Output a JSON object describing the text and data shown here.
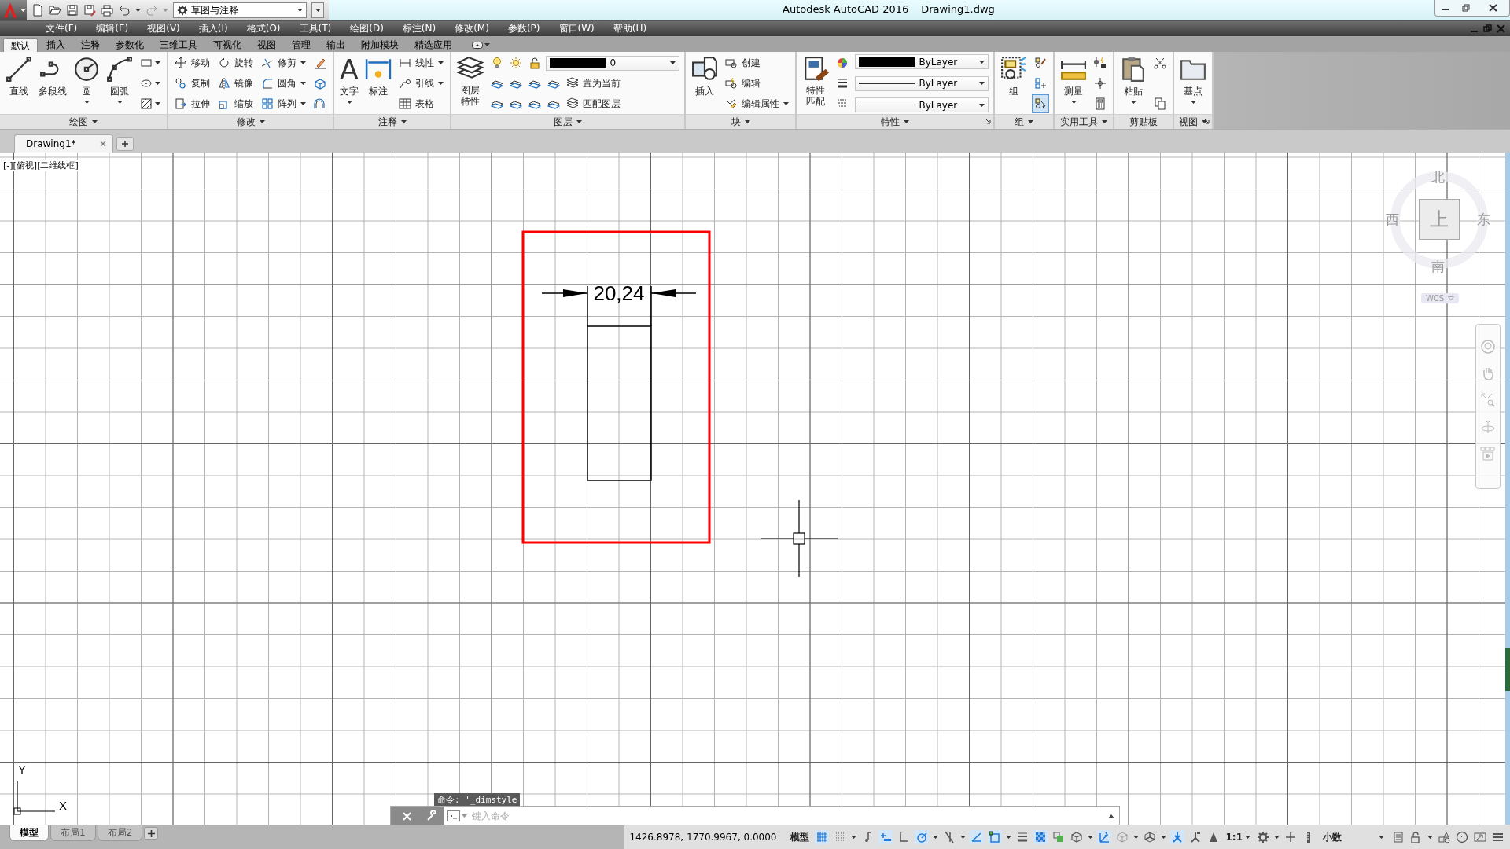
{
  "title_bar": {
    "workspace": "草图与注释",
    "title": "Autodesk AutoCAD 2016",
    "document": "Drawing1.dwg"
  },
  "menu_bar": [
    "文件(F)",
    "编辑(E)",
    "视图(V)",
    "插入(I)",
    "格式(O)",
    "工具(T)",
    "绘图(D)",
    "标注(N)",
    "修改(M)",
    "参数(P)",
    "窗口(W)",
    "帮助(H)"
  ],
  "ribbon_tabs": [
    {
      "label": "默认",
      "selected": true
    },
    {
      "label": "插入",
      "selected": false
    },
    {
      "label": "注释",
      "selected": false
    },
    {
      "label": "参数化",
      "selected": false
    },
    {
      "label": "三维工具",
      "selected": false
    },
    {
      "label": "可视化",
      "selected": false
    },
    {
      "label": "视图",
      "selected": false
    },
    {
      "label": "管理",
      "selected": false
    },
    {
      "label": "输出",
      "selected": false
    },
    {
      "label": "附加模块",
      "selected": false
    },
    {
      "label": "精选应用",
      "selected": false
    }
  ],
  "ribbon_panels": [
    {
      "title": "绘图",
      "expandable": true,
      "launcher": false,
      "columns": [
        [
          {
            "kind": "large",
            "label": "直线",
            "dropdown": false
          }
        ],
        [
          {
            "kind": "large",
            "label": "多段线",
            "dropdown": false
          }
        ],
        [
          {
            "kind": "large",
            "label": "圆",
            "dropdown": true
          }
        ],
        [
          {
            "kind": "large",
            "label": "圆弧",
            "dropdown": true
          }
        ],
        [
          {
            "kind": "icon",
            "dropdown": true
          },
          {
            "kind": "icon",
            "dropdown": true
          },
          {
            "kind": "icon",
            "dropdown": true
          }
        ]
      ]
    },
    {
      "title": "修改",
      "expandable": true,
      "launcher": false,
      "columns": [
        [
          {
            "kind": "small",
            "label": "移动",
            "dropdown": false
          },
          {
            "kind": "small",
            "label": "复制",
            "dropdown": false
          },
          {
            "kind": "small",
            "label": "拉伸",
            "dropdown": false
          }
        ],
        [
          {
            "kind": "small",
            "label": "旋转",
            "dropdown": false
          },
          {
            "kind": "small",
            "label": "镜像",
            "dropdown": false
          },
          {
            "kind": "small",
            "label": "缩放",
            "dropdown": false
          }
        ],
        [
          {
            "kind": "small",
            "label": "修剪",
            "dropdown": true
          },
          {
            "kind": "small",
            "label": "圆角",
            "dropdown": true
          },
          {
            "kind": "small",
            "label": "阵列",
            "dropdown": true
          }
        ],
        [
          {
            "kind": "icon",
            "dropdown": false
          },
          {
            "kind": "icon",
            "dropdown": false
          },
          {
            "kind": "icon",
            "dropdown": false
          }
        ]
      ]
    },
    {
      "title": "注释",
      "expandable": true,
      "launcher": false,
      "columns": [
        [
          {
            "kind": "large",
            "label": "文字",
            "glyph": "A",
            "dropdown": true
          }
        ],
        [
          {
            "kind": "large",
            "label": "标注",
            "dropdown": false
          }
        ],
        [
          {
            "kind": "small",
            "label": "线性",
            "dropdown": true
          },
          {
            "kind": "small",
            "label": "引线",
            "dropdown": true
          },
          {
            "kind": "small",
            "label": "表格",
            "dropdown": false
          }
        ]
      ]
    },
    {
      "title": "图层",
      "expandable": true,
      "launcher": false,
      "columns": [
        [
          {
            "kind": "large",
            "label": "图层特性",
            "dropdown": false
          }
        ],
        [
          {
            "kind": "row",
            "items": [
              {
                "kind": "icon",
                "dropdown": false
              },
              {
                "kind": "icon",
                "dropdown": false
              },
              {
                "kind": "icon",
                "dropdown": false
              },
              {
                "kind": "combo",
                "value": "0",
                "swatch": true
              }
            ]
          },
          {
            "kind": "row",
            "items": [
              {
                "kind": "icon",
                "dropdown": false
              },
              {
                "kind": "icon",
                "dropdown": false
              },
              {
                "kind": "icon",
                "dropdown": false
              },
              {
                "kind": "icon",
                "dropdown": false
              },
              {
                "kind": "small",
                "label": "置为当前",
                "dropdown": false
              }
            ]
          },
          {
            "kind": "row",
            "items": [
              {
                "kind": "icon",
                "dropdown": false
              },
              {
                "kind": "icon",
                "dropdown": false
              },
              {
                "kind": "icon",
                "dropdown": false
              },
              {
                "kind": "icon",
                "dropdown": false
              },
              {
                "kind": "small",
                "label": "匹配图层",
                "dropdown": false
              }
            ]
          }
        ]
      ]
    },
    {
      "title": "块",
      "expandable": true,
      "launcher": false,
      "columns": [
        [
          {
            "kind": "large",
            "label": "插入",
            "dropdown": false
          }
        ],
        [
          {
            "kind": "small",
            "label": "创建",
            "dropdown": false
          },
          {
            "kind": "small",
            "label": "编辑",
            "dropdown": false
          },
          {
            "kind": "small",
            "label": "编辑属性",
            "dropdown": true
          }
        ]
      ]
    },
    {
      "title": "特性",
      "expandable": true,
      "launcher": true,
      "columns": [
        [
          {
            "kind": "large",
            "label": "特性匹配",
            "dropdown": false
          }
        ],
        [
          {
            "kind": "icon",
            "dropdown": false
          },
          {
            "kind": "icon",
            "dropdown": false
          },
          {
            "kind": "icon",
            "dropdown": false
          }
        ],
        [
          {
            "kind": "combo",
            "value": "ByLayer",
            "swatch": true
          },
          {
            "kind": "combo",
            "value": "ByLayer",
            "swatch": false
          },
          {
            "kind": "combo",
            "value": "ByLayer",
            "swatch": false
          }
        ]
      ]
    },
    {
      "title": "组",
      "expandable": true,
      "launcher": false,
      "columns": [
        [
          {
            "kind": "large",
            "label": "组",
            "dropdown": false
          }
        ],
        [
          {
            "kind": "icon",
            "dropdown": false,
            "on": false
          },
          {
            "kind": "icon",
            "dropdown": false,
            "on": false
          },
          {
            "kind": "icon",
            "dropdown": false,
            "on": true
          }
        ]
      ]
    },
    {
      "title": "实用工具",
      "expandable": true,
      "launcher": false,
      "columns": [
        [
          {
            "kind": "large",
            "label": "测量",
            "dropdown": true
          }
        ],
        [
          {
            "kind": "icon",
            "dropdown": false
          },
          {
            "kind": "icon",
            "dropdown": false
          },
          {
            "kind": "icon",
            "dropdown": false
          }
        ]
      ]
    },
    {
      "title": "剪贴板",
      "expandable": false,
      "launcher": false,
      "columns": [
        [
          {
            "kind": "large",
            "label": "粘贴",
            "dropdown": true
          }
        ],
        [
          {
            "kind": "icon",
            "dropdown": false
          },
          {
            "kind": "icon",
            "dropdown": false
          }
        ]
      ]
    },
    {
      "title": "视图",
      "expandable": true,
      "launcher": true,
      "columns": [
        [
          {
            "kind": "large",
            "label": "基点",
            "dropdown": true
          }
        ]
      ]
    }
  ],
  "document_tabs": [
    {
      "label": "Drawing1*",
      "selected": true
    }
  ],
  "viewport": {
    "label": "[-][俯视][二维线框]",
    "dimension_text": "20,24",
    "axis_y": "Y",
    "axis_x": "X"
  },
  "view_cube": {
    "north": "北",
    "west": "西",
    "east": "东",
    "south": "南",
    "face": "上",
    "coordinate_system": "WCS"
  },
  "command_line": {
    "history": "命令: '_dimstyle",
    "placeholder": "键入命令"
  },
  "layout_tabs": [
    {
      "label": "模型",
      "selected": true
    },
    {
      "label": "布局1",
      "selected": false
    },
    {
      "label": "布局2",
      "selected": false
    }
  ],
  "coordinates": "1426.8978, 1770.9967, 0.0000",
  "status_tools": [
    {
      "kind": "text",
      "label": "模型",
      "dropdown": false
    },
    {
      "kind": "icon",
      "on": true,
      "dropdown": false
    },
    {
      "kind": "icon",
      "on": false,
      "dropdown": true
    },
    {
      "kind": "icon",
      "on": false,
      "dropdown": false
    },
    {
      "kind": "icon",
      "on": true,
      "dropdown": false
    },
    {
      "kind": "icon",
      "on": false,
      "dropdown": false
    },
    {
      "kind": "icon",
      "on": true,
      "dropdown": true
    },
    {
      "kind": "icon",
      "on": false,
      "dropdown": true
    },
    {
      "kind": "icon",
      "on": true,
      "dropdown": false
    },
    {
      "kind": "icon",
      "on": true,
      "dropdown": true
    },
    {
      "kind": "icon",
      "on": false,
      "dropdown": false
    },
    {
      "kind": "icon",
      "on": true,
      "dropdown": false
    },
    {
      "kind": "icon",
      "on": false,
      "dropdown": false
    },
    {
      "kind": "icon",
      "on": false,
      "dropdown": true
    },
    {
      "kind": "icon",
      "on": true,
      "dropdown": false
    },
    {
      "kind": "icon",
      "on": false,
      "dropdown": true
    },
    {
      "kind": "icon",
      "on": false,
      "dropdown": true
    },
    {
      "kind": "icon",
      "on": true,
      "dropdown": false
    },
    {
      "kind": "icon",
      "on": false,
      "dropdown": false
    },
    {
      "kind": "icon",
      "on": false,
      "dropdown": false
    },
    {
      "kind": "text",
      "label": "1:1",
      "dropdown": true
    },
    {
      "kind": "icon",
      "on": false,
      "dropdown": true
    },
    {
      "kind": "icon",
      "on": false,
      "dropdown": false
    },
    {
      "kind": "icon",
      "on": false,
      "dropdown": false
    },
    {
      "kind": "field",
      "label": "小数",
      "dropdown": true
    },
    {
      "kind": "icon",
      "on": false,
      "dropdown": false
    },
    {
      "kind": "icon",
      "on": false,
      "dropdown": true
    },
    {
      "kind": "icon",
      "on": false,
      "dropdown": false
    },
    {
      "kind": "icon",
      "on": false,
      "dropdown": false
    },
    {
      "kind": "icon",
      "on": false,
      "dropdown": false
    },
    {
      "kind": "icon",
      "on": false,
      "dropdown": false
    }
  ]
}
